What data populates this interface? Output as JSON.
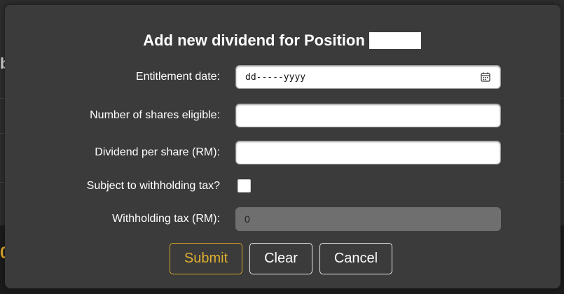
{
  "background": {
    "left_glyph": "b",
    "left_glyph_bottom": "0"
  },
  "dialog": {
    "title": "Add new dividend for Position",
    "fields": {
      "entitlement_date": {
        "label": "Entitlement date:",
        "placeholder": "dd-----yyyy",
        "icon": "calendar-icon"
      },
      "shares_eligible": {
        "label": "Number of shares eligible:",
        "value": ""
      },
      "dividend_per_share": {
        "label": "Dividend per share (RM):",
        "value": ""
      },
      "withholding_subject": {
        "label": "Subject to withholding tax?",
        "checked": false
      },
      "withholding_tax": {
        "label": "Withholding tax (RM):",
        "value": "0",
        "disabled": true
      }
    },
    "buttons": {
      "submit": "Submit",
      "clear": "Clear",
      "cancel": "Cancel"
    }
  },
  "colors": {
    "modal_bg": "#3b3b3b",
    "accent": "#e0b030",
    "disabled_field": "#6f6f6f"
  }
}
